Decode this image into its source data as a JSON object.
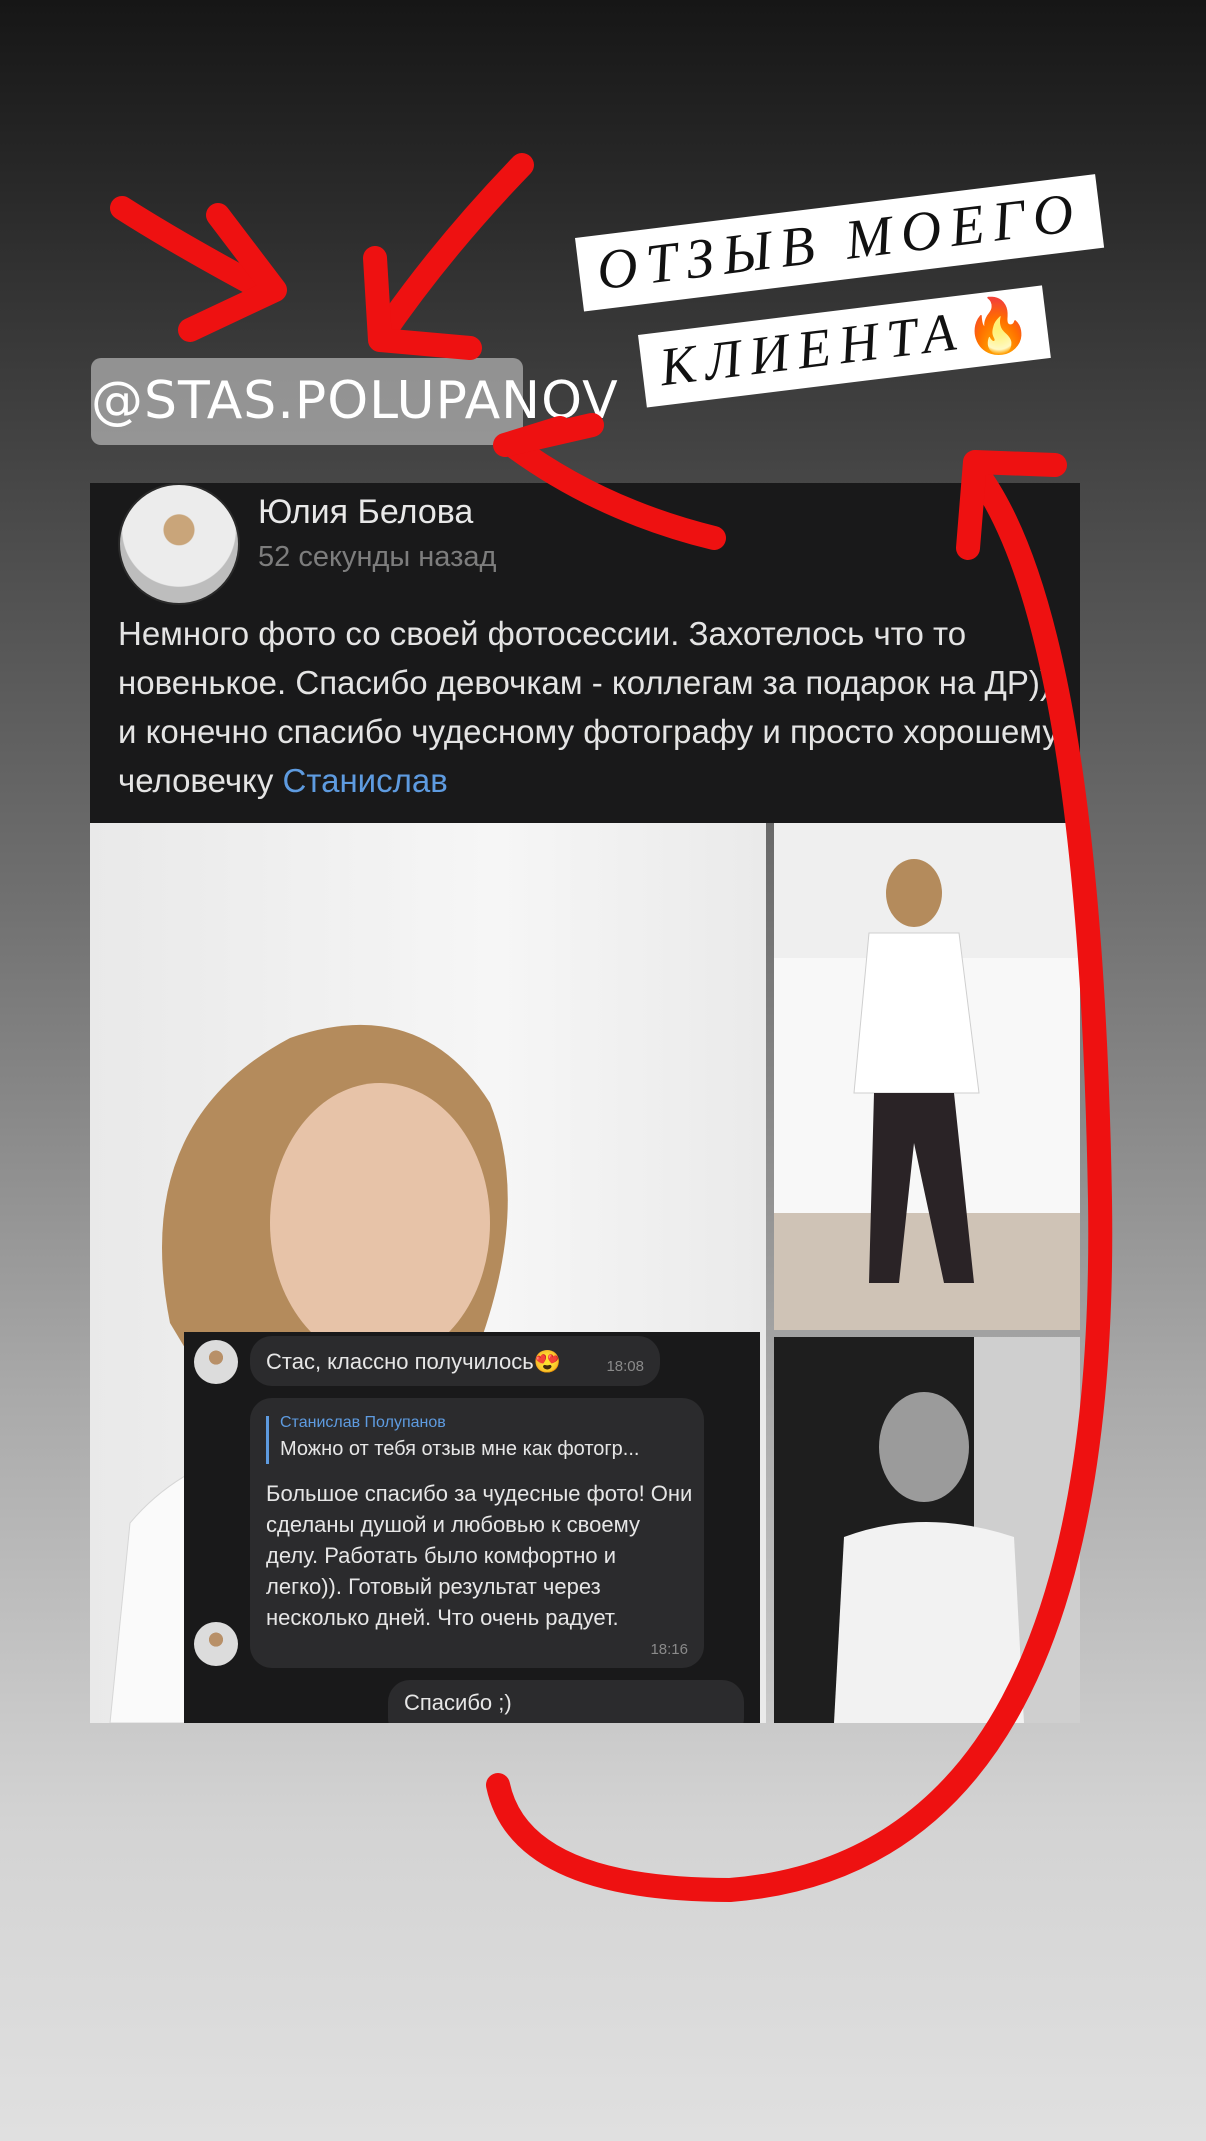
{
  "story": {
    "mention": "@STAS.POLUPANOV",
    "sticker_line1": "ОТЗЫВ МОЕГО",
    "sticker_line2": "КЛИЕНТА",
    "sticker_emoji": "🔥"
  },
  "post": {
    "author": "Юлия Белова",
    "time": "52 секунды назад",
    "text": "Немного фото со своей фотосессии. Захотелось что то новенькое. Спасибо девочкам - коллегам за подарок на ДР))) и конечно спасибо чудесному фотографу и просто хорошему человечку ",
    "link": "Станислав"
  },
  "chat": {
    "msg1": "Стас, классно получилось😍",
    "msg1_time": "18:08",
    "quote_author": "Станислав Полупанов",
    "quote_text": "Можно от тебя отзыв мне как фотогр...",
    "msg2": "Большое спасибо за чудесные фото! Они сделаны душой и любовью к своему делу. Работать было комфортно и легко)). Готовый результат через несколько дней. Что очень радует.",
    "msg2_time": "18:16",
    "msg3": "Спасибо ;)"
  },
  "colors": {
    "arrow": "#ee1111",
    "link": "#5e9be0",
    "post_bg": "#19191a"
  }
}
